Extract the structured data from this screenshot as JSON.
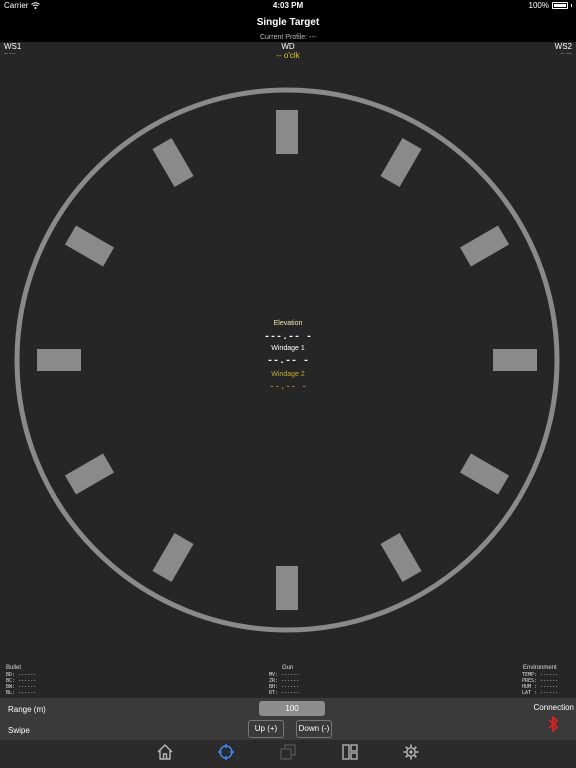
{
  "status_bar": {
    "carrier": "Carrier",
    "time": "4:03 PM",
    "battery": "100%"
  },
  "nav": {
    "title": "Single Target",
    "profile": "Current Profile: ---"
  },
  "wind": {
    "ws1_label": "WS1",
    "ws1_value": "-- ---",
    "wd_label": "WD",
    "wd_value": "-- o'clk",
    "ws2_label": "WS2",
    "ws2_value": "-- ---"
  },
  "solution": {
    "elevation_label": "Elevation",
    "elevation_value": "---.-- -",
    "windage1_label": "Windage 1",
    "windage1_value": "--.-- -",
    "windage2_label": "Windage 2",
    "windage2_value": "--.-- -"
  },
  "info": {
    "bullet": {
      "title": "Bullet",
      "lines": [
        "BD: ------",
        "BC: ------",
        "BW: ------",
        "BL: ------"
      ]
    },
    "gun": {
      "title": "Gun",
      "lines": [
        "MV: ------",
        "ZR: ------",
        "BH: ------",
        "RT: ------"
      ]
    },
    "environment": {
      "title": "Environment",
      "lines": [
        "TEMP: ------",
        "PRES: ------",
        "HUM : ------",
        "LAT : ------"
      ]
    }
  },
  "controls": {
    "range_label": "Range (m)",
    "range_value": "100",
    "swipe_label": "Swipe",
    "up_label": "Up (+)",
    "down_label": "Down (-)",
    "connection_label": "Connection"
  },
  "tabs": [
    {
      "icon": "home-icon"
    },
    {
      "icon": "crosshair-icon"
    },
    {
      "icon": "copy-icon"
    },
    {
      "icon": "layout-icon"
    },
    {
      "icon": "gear-icon"
    }
  ],
  "colors": {
    "accent": "#e2c32f",
    "windage2": "#c9a827",
    "active_tab": "#3d8df5",
    "bluetooth": "#e02020",
    "dial": "#8a8a8a"
  }
}
